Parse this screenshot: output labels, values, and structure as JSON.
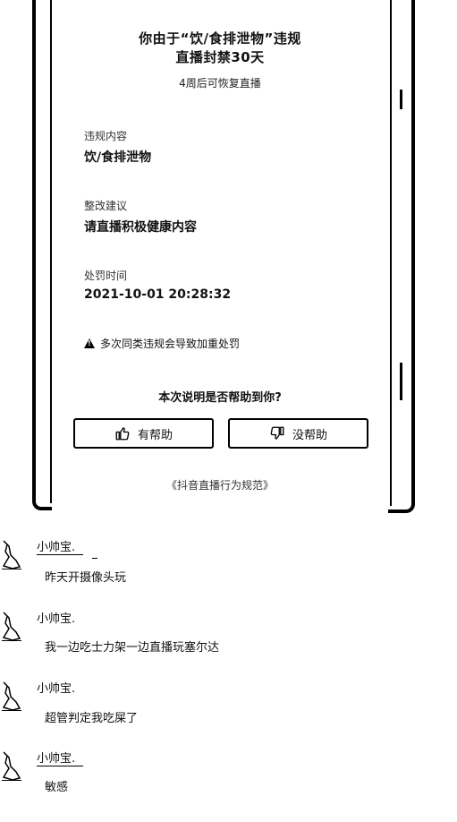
{
  "notice": {
    "title_line1": "你由于“饮/食排泄物”违规",
    "title_line2": "直播封禁30天",
    "subtitle": "4周后可恢复直播",
    "violation_label": "违规内容",
    "violation_value": "饮/食排泄物",
    "suggestion_label": "整改建议",
    "suggestion_value": "请直播积极健康内容",
    "time_label": "处罚时间",
    "time_value": "2021-10-01 20:28:32",
    "warning_text": "多次同类违规会导致加重处罚",
    "question": "本次说明是否帮助到你?",
    "helpful_label": "有帮助",
    "not_helpful_label": "没帮助",
    "footer_link": "《抖音直播行为规范》"
  },
  "comments": [
    {
      "user": "小帅宝.",
      "text": "昨天开摄像头玩"
    },
    {
      "user": "小帅宝.",
      "text": "我一边吃士力架一边直播玩塞尔达"
    },
    {
      "user": "小帅宝.",
      "text": "超管判定我吃屎了"
    },
    {
      "user": "小帅宝.",
      "text": "敏感"
    }
  ]
}
